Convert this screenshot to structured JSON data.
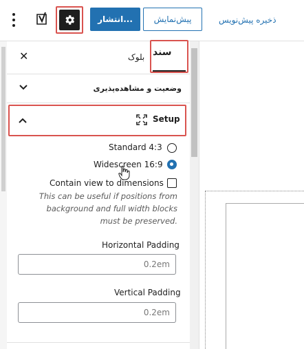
{
  "toolbar": {
    "save_draft_label": "ذخیره پیش‌نویس",
    "preview_label": "پیش‌نمایش",
    "publish_label": "انتشار..."
  },
  "sidebar": {
    "tab_document": "سند",
    "tab_block": "بلوک",
    "panel_status_title": "وضعیت و مشاهده‌پذیری",
    "setup_title": "Setup",
    "options": {
      "standard": "Standard 4:3",
      "widescreen": "Widescreen 16:9",
      "selected": "Widescreen 16:9"
    },
    "contain_label": "Contain view to dimensions",
    "help_text": "This can be useful if positions from background and full width blocks must be preserved.",
    "horizontal_padding_label": "Horizontal Padding",
    "horizontal_padding_value": "0.2em",
    "vertical_padding_label": "Vertical Padding",
    "vertical_padding_value": "0.2em"
  },
  "colors": {
    "accent": "#2271b1",
    "highlight": "#d9534f",
    "dark": "#1e1e1e"
  }
}
